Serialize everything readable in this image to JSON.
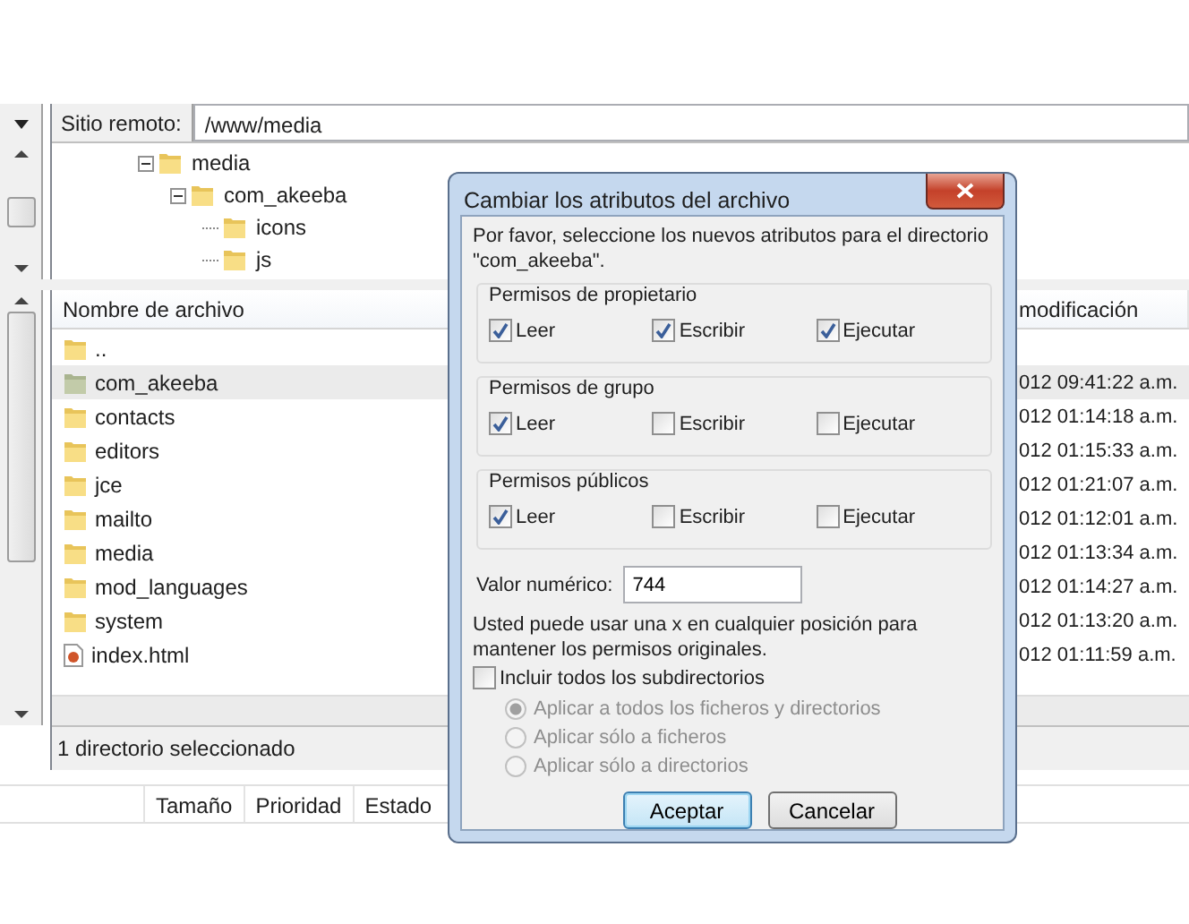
{
  "remote_site": {
    "label": "Sitio remoto:",
    "path": "/www/media"
  },
  "tree": [
    {
      "name": "media",
      "expanded": true,
      "children": [
        {
          "name": "com_akeeba",
          "expanded": true,
          "children": [
            {
              "name": "icons"
            },
            {
              "name": "js"
            }
          ]
        }
      ]
    }
  ],
  "file_list": {
    "columns": [
      "Nombre de archivo",
      "modificación"
    ],
    "rows": [
      {
        "name": "..",
        "kind": "folder",
        "selected": false
      },
      {
        "name": "com_akeeba",
        "kind": "folder",
        "selected": true,
        "modified": "012 09:41:22 a.m."
      },
      {
        "name": "contacts",
        "kind": "folder",
        "selected": false,
        "modified": "012 01:14:18 a.m."
      },
      {
        "name": "editors",
        "kind": "folder",
        "selected": false,
        "modified": "012 01:15:33 a.m."
      },
      {
        "name": "jce",
        "kind": "folder",
        "selected": false,
        "modified": "012 01:21:07 a.m."
      },
      {
        "name": "mailto",
        "kind": "folder",
        "selected": false,
        "modified": "012 01:12:01 a.m."
      },
      {
        "name": "media",
        "kind": "folder",
        "selected": false,
        "modified": "012 01:13:34 a.m."
      },
      {
        "name": "mod_languages",
        "kind": "folder",
        "selected": false,
        "modified": "012 01:14:27 a.m."
      },
      {
        "name": "system",
        "kind": "folder",
        "selected": false,
        "modified": "012 01:13:20 a.m."
      },
      {
        "name": "index.html",
        "kind": "file",
        "selected": false,
        "modified": "012 01:11:59 a.m."
      }
    ]
  },
  "status_bar": "1 directorio seleccionado",
  "queue_columns": [
    "Tamaño",
    "Prioridad",
    "Estado"
  ],
  "dialog": {
    "title": "Cambiar los atributos del archivo",
    "intro": "Por favor, seleccione los nuevos atributos para el directorio \"com_akeeba\".",
    "groups": [
      {
        "title": "Permisos de propietario",
        "permissions": [
          {
            "label": "Leer",
            "checked": true
          },
          {
            "label": "Escribir",
            "checked": true
          },
          {
            "label": "Ejecutar",
            "checked": true
          }
        ]
      },
      {
        "title": "Permisos de grupo",
        "permissions": [
          {
            "label": "Leer",
            "checked": true
          },
          {
            "label": "Escribir",
            "checked": false
          },
          {
            "label": "Ejecutar",
            "checked": false
          }
        ]
      },
      {
        "title": "Permisos públicos",
        "permissions": [
          {
            "label": "Leer",
            "checked": true
          },
          {
            "label": "Escribir",
            "checked": false
          },
          {
            "label": "Ejecutar",
            "checked": false
          }
        ]
      }
    ],
    "numeric": {
      "label": "Valor numérico:",
      "value": "744"
    },
    "note": "Usted puede usar una x en cualquier posición para mantener los permisos originales.",
    "include_subdirs": {
      "label": "Incluir todos los subdirectorios",
      "checked": false
    },
    "apply_options": [
      {
        "label": "Aplicar a todos los ficheros y directorios",
        "selected": true,
        "disabled": true
      },
      {
        "label": "Aplicar sólo a ficheros",
        "selected": false,
        "disabled": true
      },
      {
        "label": "Aplicar sólo a directorios",
        "selected": false,
        "disabled": true
      }
    ],
    "buttons": [
      {
        "label": "Aceptar",
        "default": true
      },
      {
        "label": "Cancelar",
        "default": false
      }
    ]
  }
}
